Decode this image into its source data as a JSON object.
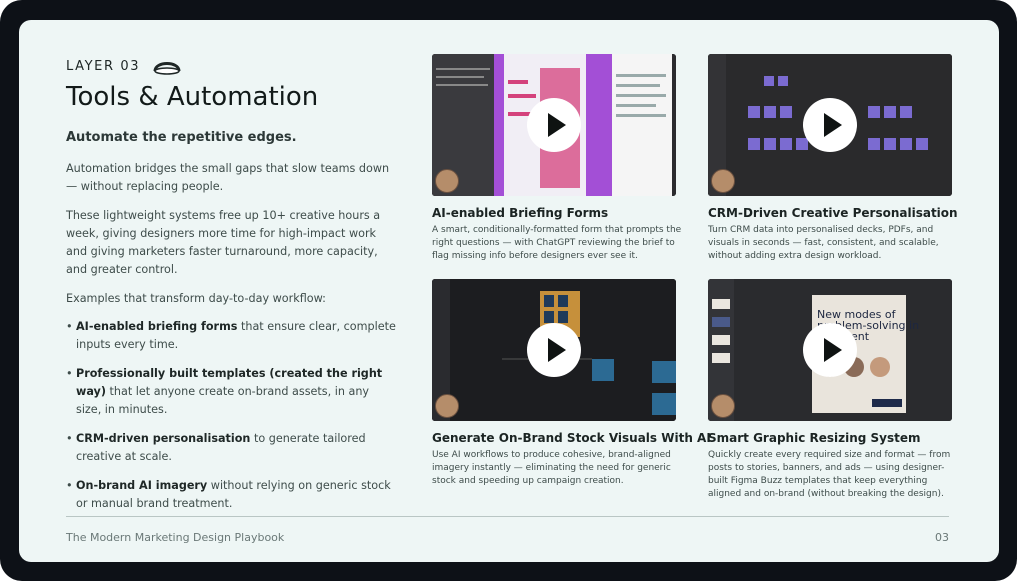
{
  "layer_label": "LAYER 03",
  "title": "Tools & Automation",
  "subtitle": "Automate the repetitive edges.",
  "paragraphs": [
    "Automation bridges the small gaps that slow teams down — without replacing people.",
    "These lightweight systems free up 10+ creative hours a week, giving designers more time for high-impact work and giving marketers faster turnaround, more capacity, and greater control.",
    "Examples that transform day-to-day workflow:"
  ],
  "bullets": [
    {
      "bold": "AI-enabled briefing forms",
      "rest": " that ensure clear, complete inputs every time."
    },
    {
      "bold": "Professionally built templates (created the right way)",
      "rest": " that let anyone create on-brand assets, in any size, in minutes."
    },
    {
      "bold": "CRM-driven personalisation",
      "rest": " to generate tailored creative at scale."
    },
    {
      "bold": "On-brand AI imagery",
      "rest": " without relying on generic stock or manual brand treatment."
    }
  ],
  "cards": [
    {
      "title": "AI-enabled Briefing Forms",
      "description": "A smart, conditionally-formatted form that prompts the right questions — with ChatGPT reviewing the brief to flag missing info before designers ever see it."
    },
    {
      "title": "CRM-Driven Creative Personalisation",
      "description": "Turn CRM data into personalised decks, PDFs, and visuals in seconds — fast, consistent, and scalable, without adding extra design workload."
    },
    {
      "title": "Generate On-Brand Stock Visuals With AI",
      "description": "Use AI workflows to produce cohesive, brand-aligned imagery instantly — eliminating the need for generic stock and speeding up campaign creation."
    },
    {
      "title": "Smart Graphic Resizing System",
      "description": "Quickly create every required size and format — from posts to stories, banners, and ads — using designer-built Figma Buzz templates that keep everything aligned and on-brand (without breaking the design)."
    }
  ],
  "thumb4": {
    "headline_1": "New modes of",
    "headline_2": "problem-solving in",
    "headline_3": "ent"
  },
  "footer": {
    "left": "The Modern Marketing Design Playbook",
    "right": "03"
  },
  "colors": {
    "background": "#eef6f5",
    "frame": "#0d1117",
    "text": "#3e4c4a",
    "heading": "#121a19",
    "form_pink": "#d4427c",
    "form_purple": "#a34fd6"
  },
  "icons": [
    "layer-dome-icon",
    "play-icon"
  ]
}
